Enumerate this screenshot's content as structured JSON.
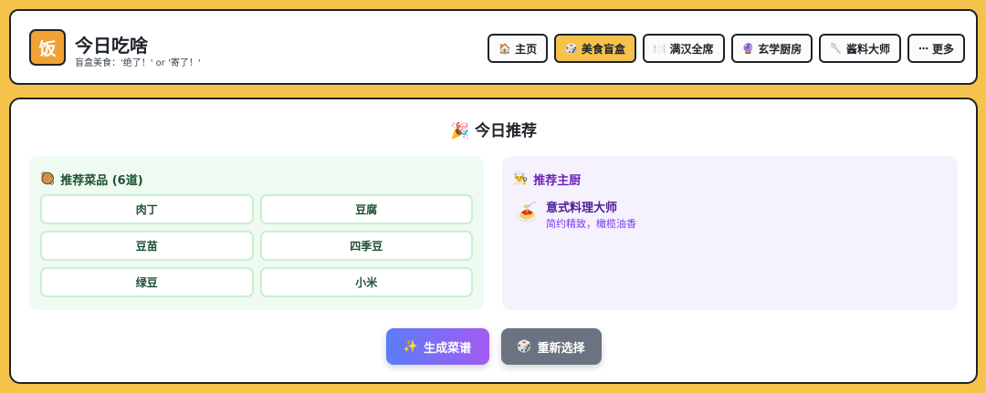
{
  "header": {
    "logo_char": "饭",
    "title": "今日吃啥",
    "subtitle": "盲盒美食：'绝了！' or '寄了！'"
  },
  "nav": [
    {
      "icon": "🏠",
      "label": "主页"
    },
    {
      "icon": "🎲",
      "label": "美食盲盒",
      "active": true
    },
    {
      "icon": "🍽️",
      "label": "满汉全席"
    },
    {
      "icon": "🔮",
      "label": "玄学厨房"
    },
    {
      "icon": "🥄",
      "label": "酱料大师"
    },
    {
      "icon": "⋯",
      "label": "更多"
    }
  ],
  "main": {
    "title_icon": "🎉",
    "title": "今日推荐",
    "dishes": {
      "icon": "🥘",
      "heading": "推荐菜品 (6道)",
      "items": [
        "肉丁",
        "豆腐",
        "豆苗",
        "四季豆",
        "绿豆",
        "小米"
      ]
    },
    "chef": {
      "icon": "👨‍🍳",
      "heading": "推荐主厨",
      "avatar": "🍝",
      "name": "意式料理大师",
      "desc": "简约精致，橄榄油香"
    },
    "actions": {
      "generate_icon": "✨",
      "generate_label": "生成菜谱",
      "reselect_icon": "🎲",
      "reselect_label": "重新选择"
    }
  },
  "colors": {
    "background": "#f5c34c",
    "accent": "#f0a235",
    "green_panel": "#effaf1",
    "purple_panel": "#f5f2fe"
  }
}
